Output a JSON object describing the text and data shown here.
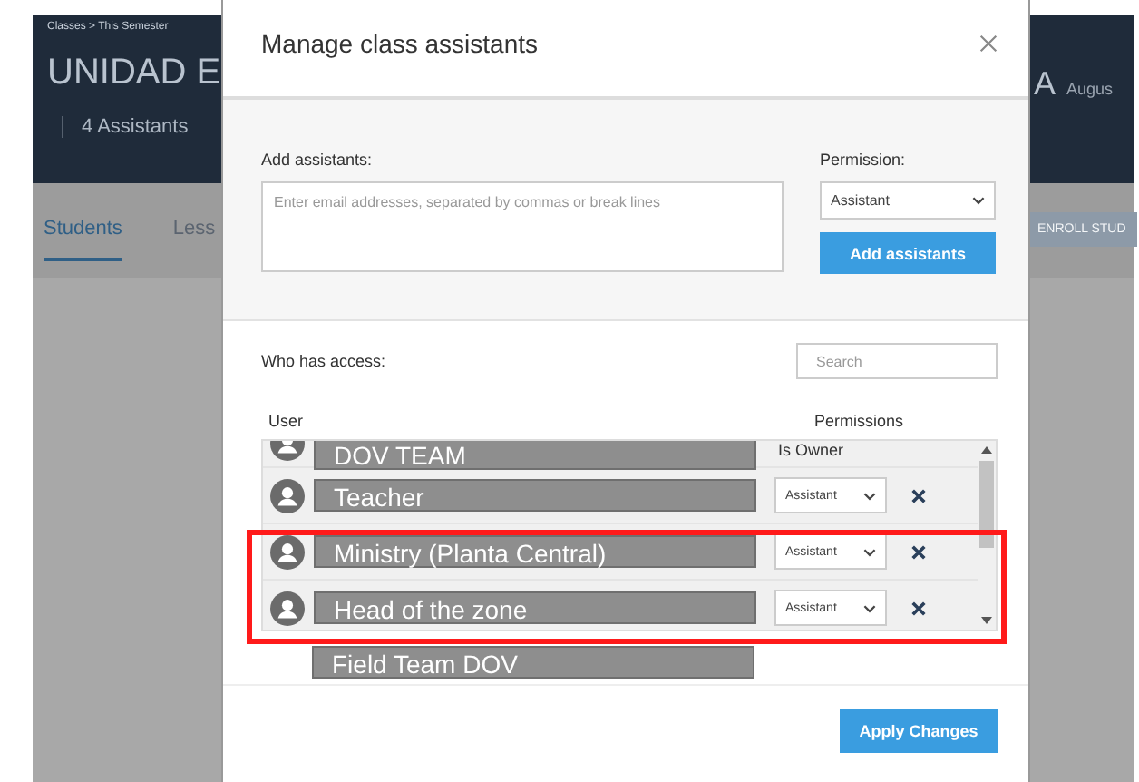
{
  "page": {
    "breadcrumb": "Classes > This Semester",
    "title": "UNIDAD E",
    "assistants_menu": "4 Assistants",
    "avatar_letter": "A",
    "user_name": "Augus",
    "tabs": [
      {
        "label": "Students",
        "selected": true
      },
      {
        "label": "Less",
        "selected": false
      }
    ],
    "enroll_button": "ENROLL STUD"
  },
  "dialog": {
    "title": "Manage class assistants",
    "add_label": "Add assistants:",
    "email_placeholder": "Enter email addresses, separated by commas or break lines",
    "permission_label": "Permission:",
    "permission_value": "Assistant",
    "add_button": "Add assistants",
    "access_label": "Who has access:",
    "search_placeholder": "Search",
    "columns": [
      "User",
      "Permissions"
    ],
    "users": [
      {
        "name": "DOV TEAM",
        "kind": "owner",
        "permission": "Is Owner"
      },
      {
        "name": "Teacher",
        "kind": "member",
        "permission": "Assistant"
      },
      {
        "name": "Ministry (Planta Central)",
        "kind": "member",
        "permission": "Assistant"
      },
      {
        "name": "Head of the zone",
        "kind": "member",
        "permission": "Assistant"
      }
    ],
    "extra_label": "Field Team DOV",
    "apply_button": "Apply Changes"
  }
}
